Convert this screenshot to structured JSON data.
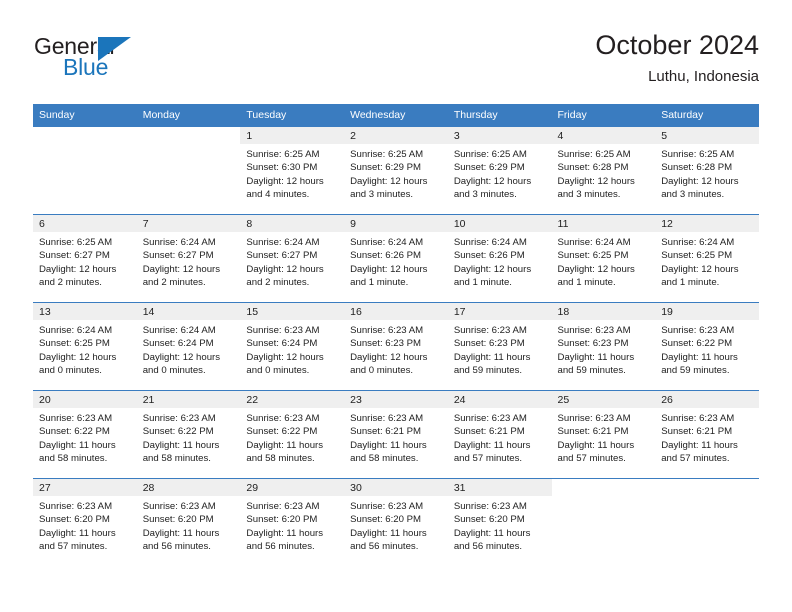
{
  "brand": {
    "name_part1": "General",
    "name_part2": "Blue"
  },
  "header": {
    "title": "October 2024",
    "location": "Luthu, Indonesia"
  },
  "calendar": {
    "weekday_headers": [
      "Sunday",
      "Monday",
      "Tuesday",
      "Wednesday",
      "Thursday",
      "Friday",
      "Saturday"
    ],
    "accent_color": "#3a7cc0",
    "daynum_band_color": "#efefef",
    "weeks": [
      [
        {
          "day": "",
          "blank": true
        },
        {
          "day": "",
          "blank": true
        },
        {
          "day": "1",
          "sunrise": "Sunrise: 6:25 AM",
          "sunset": "Sunset: 6:30 PM",
          "daylight": "Daylight: 12 hours and 4 minutes."
        },
        {
          "day": "2",
          "sunrise": "Sunrise: 6:25 AM",
          "sunset": "Sunset: 6:29 PM",
          "daylight": "Daylight: 12 hours and 3 minutes."
        },
        {
          "day": "3",
          "sunrise": "Sunrise: 6:25 AM",
          "sunset": "Sunset: 6:29 PM",
          "daylight": "Daylight: 12 hours and 3 minutes."
        },
        {
          "day": "4",
          "sunrise": "Sunrise: 6:25 AM",
          "sunset": "Sunset: 6:28 PM",
          "daylight": "Daylight: 12 hours and 3 minutes."
        },
        {
          "day": "5",
          "sunrise": "Sunrise: 6:25 AM",
          "sunset": "Sunset: 6:28 PM",
          "daylight": "Daylight: 12 hours and 3 minutes."
        }
      ],
      [
        {
          "day": "6",
          "sunrise": "Sunrise: 6:25 AM",
          "sunset": "Sunset: 6:27 PM",
          "daylight": "Daylight: 12 hours and 2 minutes."
        },
        {
          "day": "7",
          "sunrise": "Sunrise: 6:24 AM",
          "sunset": "Sunset: 6:27 PM",
          "daylight": "Daylight: 12 hours and 2 minutes."
        },
        {
          "day": "8",
          "sunrise": "Sunrise: 6:24 AM",
          "sunset": "Sunset: 6:27 PM",
          "daylight": "Daylight: 12 hours and 2 minutes."
        },
        {
          "day": "9",
          "sunrise": "Sunrise: 6:24 AM",
          "sunset": "Sunset: 6:26 PM",
          "daylight": "Daylight: 12 hours and 1 minute."
        },
        {
          "day": "10",
          "sunrise": "Sunrise: 6:24 AM",
          "sunset": "Sunset: 6:26 PM",
          "daylight": "Daylight: 12 hours and 1 minute."
        },
        {
          "day": "11",
          "sunrise": "Sunrise: 6:24 AM",
          "sunset": "Sunset: 6:25 PM",
          "daylight": "Daylight: 12 hours and 1 minute."
        },
        {
          "day": "12",
          "sunrise": "Sunrise: 6:24 AM",
          "sunset": "Sunset: 6:25 PM",
          "daylight": "Daylight: 12 hours and 1 minute."
        }
      ],
      [
        {
          "day": "13",
          "sunrise": "Sunrise: 6:24 AM",
          "sunset": "Sunset: 6:25 PM",
          "daylight": "Daylight: 12 hours and 0 minutes."
        },
        {
          "day": "14",
          "sunrise": "Sunrise: 6:24 AM",
          "sunset": "Sunset: 6:24 PM",
          "daylight": "Daylight: 12 hours and 0 minutes."
        },
        {
          "day": "15",
          "sunrise": "Sunrise: 6:23 AM",
          "sunset": "Sunset: 6:24 PM",
          "daylight": "Daylight: 12 hours and 0 minutes."
        },
        {
          "day": "16",
          "sunrise": "Sunrise: 6:23 AM",
          "sunset": "Sunset: 6:23 PM",
          "daylight": "Daylight: 12 hours and 0 minutes."
        },
        {
          "day": "17",
          "sunrise": "Sunrise: 6:23 AM",
          "sunset": "Sunset: 6:23 PM",
          "daylight": "Daylight: 11 hours and 59 minutes."
        },
        {
          "day": "18",
          "sunrise": "Sunrise: 6:23 AM",
          "sunset": "Sunset: 6:23 PM",
          "daylight": "Daylight: 11 hours and 59 minutes."
        },
        {
          "day": "19",
          "sunrise": "Sunrise: 6:23 AM",
          "sunset": "Sunset: 6:22 PM",
          "daylight": "Daylight: 11 hours and 59 minutes."
        }
      ],
      [
        {
          "day": "20",
          "sunrise": "Sunrise: 6:23 AM",
          "sunset": "Sunset: 6:22 PM",
          "daylight": "Daylight: 11 hours and 58 minutes."
        },
        {
          "day": "21",
          "sunrise": "Sunrise: 6:23 AM",
          "sunset": "Sunset: 6:22 PM",
          "daylight": "Daylight: 11 hours and 58 minutes."
        },
        {
          "day": "22",
          "sunrise": "Sunrise: 6:23 AM",
          "sunset": "Sunset: 6:22 PM",
          "daylight": "Daylight: 11 hours and 58 minutes."
        },
        {
          "day": "23",
          "sunrise": "Sunrise: 6:23 AM",
          "sunset": "Sunset: 6:21 PM",
          "daylight": "Daylight: 11 hours and 58 minutes."
        },
        {
          "day": "24",
          "sunrise": "Sunrise: 6:23 AM",
          "sunset": "Sunset: 6:21 PM",
          "daylight": "Daylight: 11 hours and 57 minutes."
        },
        {
          "day": "25",
          "sunrise": "Sunrise: 6:23 AM",
          "sunset": "Sunset: 6:21 PM",
          "daylight": "Daylight: 11 hours and 57 minutes."
        },
        {
          "day": "26",
          "sunrise": "Sunrise: 6:23 AM",
          "sunset": "Sunset: 6:21 PM",
          "daylight": "Daylight: 11 hours and 57 minutes."
        }
      ],
      [
        {
          "day": "27",
          "sunrise": "Sunrise: 6:23 AM",
          "sunset": "Sunset: 6:20 PM",
          "daylight": "Daylight: 11 hours and 57 minutes."
        },
        {
          "day": "28",
          "sunrise": "Sunrise: 6:23 AM",
          "sunset": "Sunset: 6:20 PM",
          "daylight": "Daylight: 11 hours and 56 minutes."
        },
        {
          "day": "29",
          "sunrise": "Sunrise: 6:23 AM",
          "sunset": "Sunset: 6:20 PM",
          "daylight": "Daylight: 11 hours and 56 minutes."
        },
        {
          "day": "30",
          "sunrise": "Sunrise: 6:23 AM",
          "sunset": "Sunset: 6:20 PM",
          "daylight": "Daylight: 11 hours and 56 minutes."
        },
        {
          "day": "31",
          "sunrise": "Sunrise: 6:23 AM",
          "sunset": "Sunset: 6:20 PM",
          "daylight": "Daylight: 11 hours and 56 minutes."
        },
        {
          "day": "",
          "blank": true
        },
        {
          "day": "",
          "blank": true
        }
      ]
    ]
  }
}
